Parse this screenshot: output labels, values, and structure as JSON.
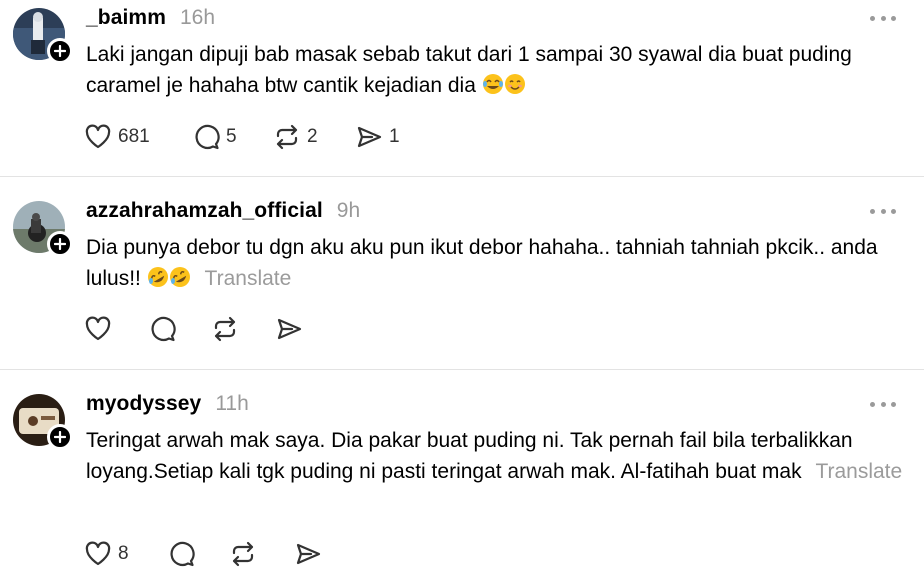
{
  "posts": [
    {
      "username": "_baimm",
      "time": "16h",
      "text": "Laki jangan dipuji bab masak sebab takut dari 1 sampai 30 syawal dia buat puding caramel je hahaha btw cantik kejadian dia",
      "emojis": [
        "face-with-tears-of-joy",
        "smiling-face"
      ],
      "translate": "",
      "likes": "681",
      "replies": "5",
      "reposts": "2",
      "shares": "1"
    },
    {
      "username": "azzahrahamzah_official",
      "time": "9h",
      "text": "Dia punya debor tu dgn aku aku pun ikut debor hahaha.. tahniah tahniah pkcik.. anda lulus!!",
      "emojis": [
        "rolling-on-floor-laughing",
        "rolling-on-floor-laughing"
      ],
      "translate": "Translate",
      "likes": "",
      "replies": "",
      "reposts": "",
      "shares": ""
    },
    {
      "username": "myodyssey",
      "time": "11h",
      "text": "Teringat arwah mak saya. Dia pakar buat puding ni. Tak pernah fail bila terbalikkan loyang.Setiap kali tgk puding ni pasti teringat arwah mak. Al-fatihah buat mak",
      "emojis": [],
      "translate": "Translate",
      "likes": "8",
      "replies": "",
      "reposts": "",
      "shares": ""
    }
  ],
  "icons": {
    "like": "heart-icon",
    "reply": "speech-bubble-icon",
    "repost": "repost-arrows-icon",
    "share": "send-arrow-icon",
    "more": "more-dots-icon",
    "follow": "plus-icon"
  },
  "colors": {
    "text": "#000000",
    "muted": "#999999",
    "divider": "#e3e3e3",
    "icon": "#333333"
  }
}
